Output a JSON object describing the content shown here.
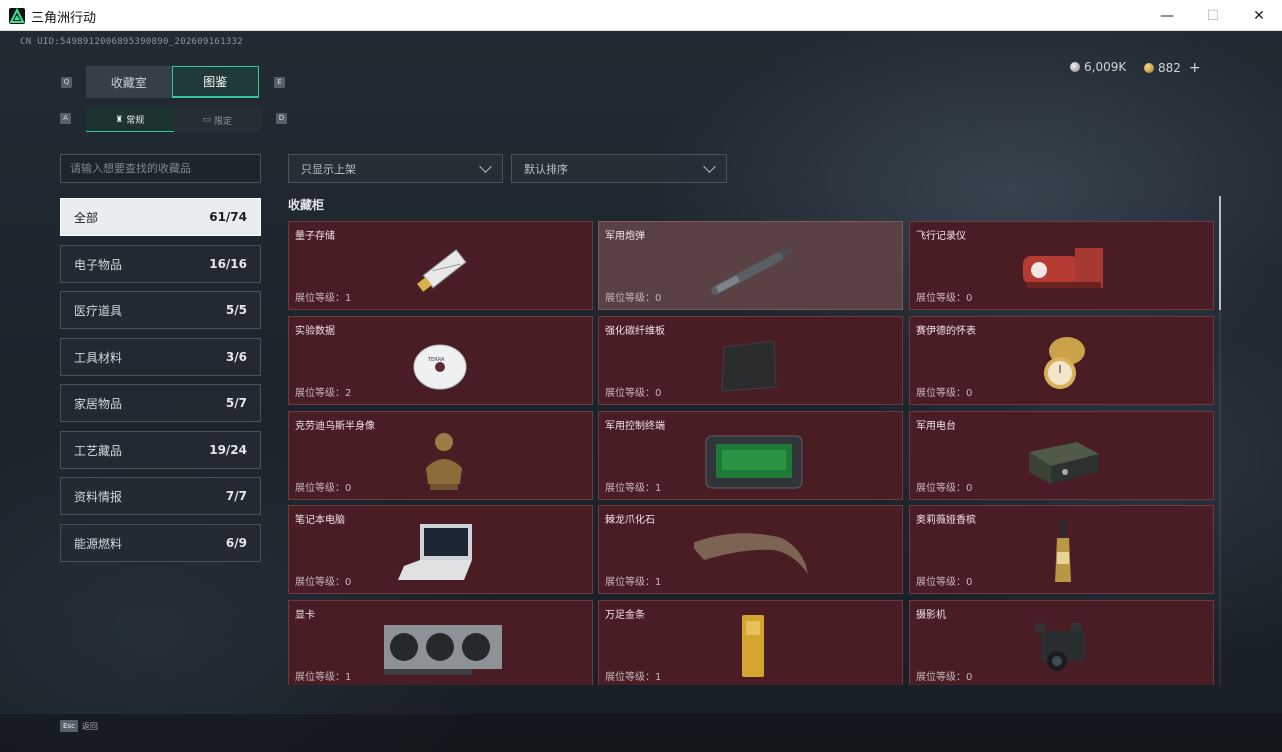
{
  "window": {
    "title": "三角洲行动",
    "min": "—",
    "max": "☐",
    "close": "✕"
  },
  "uid": "CN UID:5498912006895390890_202609161332",
  "key_hints": {
    "tab_prev": "Q",
    "tab_next": "E",
    "sub_prev": "A",
    "sub_next": "D"
  },
  "tabs": [
    {
      "label": "收藏室",
      "active": false
    },
    {
      "label": "图鉴",
      "active": true
    }
  ],
  "subtabs": [
    {
      "label": "常规",
      "active": true
    },
    {
      "label": "限定",
      "active": false
    }
  ],
  "currency": {
    "silver": "6,009K",
    "gold": "882",
    "add": "+"
  },
  "search": {
    "placeholder": "请输入想要查找的收藏品"
  },
  "filters": {
    "show": "只显示上架",
    "sort": "默认排序"
  },
  "categories": [
    {
      "label": "全部",
      "count": "61/74",
      "active": true
    },
    {
      "label": "电子物品",
      "count": "16/16"
    },
    {
      "label": "医疗道具",
      "count": "5/5"
    },
    {
      "label": "工具材料",
      "count": "3/6"
    },
    {
      "label": "家居物品",
      "count": "5/7"
    },
    {
      "label": "工艺藏品",
      "count": "19/24"
    },
    {
      "label": "资料情报",
      "count": "7/7"
    },
    {
      "label": "能源燃料",
      "count": "6/9"
    }
  ],
  "section_title": "收藏柜",
  "items": [
    {
      "name": "量子存储",
      "level": "展位等级：1",
      "icon": "usb-drive"
    },
    {
      "name": "军用炮弹",
      "level": "展位等级：0",
      "icon": "artillery-shell",
      "highlight": true
    },
    {
      "name": "飞行记录仪",
      "level": "展位等级：0",
      "icon": "flight-recorder"
    },
    {
      "name": "实验数据",
      "level": "展位等级：2",
      "icon": "data-disc"
    },
    {
      "name": "强化碳纤维板",
      "level": "展位等级：0",
      "icon": "carbon-plate"
    },
    {
      "name": "赛伊德的怀表",
      "level": "展位等级：0",
      "icon": "pocket-watch"
    },
    {
      "name": "克劳迪乌斯半身像",
      "level": "展位等级：0",
      "icon": "bust-statue"
    },
    {
      "name": "军用控制终端",
      "level": "展位等级：1",
      "icon": "control-terminal"
    },
    {
      "name": "军用电台",
      "level": "展位等级：0",
      "icon": "military-radio"
    },
    {
      "name": "笔记本电脑",
      "level": "展位等级：0",
      "icon": "laptop"
    },
    {
      "name": "棘龙爪化石",
      "level": "展位等级：1",
      "icon": "claw-fossil"
    },
    {
      "name": "奥莉薇娅香槟",
      "level": "展位等级：0",
      "icon": "champagne"
    },
    {
      "name": "显卡",
      "level": "展位等级：1",
      "icon": "graphics-card"
    },
    {
      "name": "万足金条",
      "level": "展位等级：1",
      "icon": "gold-bar"
    },
    {
      "name": "摄影机",
      "level": "展位等级：0",
      "icon": "camera"
    }
  ],
  "bottom": {
    "esc_key": "Esc",
    "esc_label": "返回"
  }
}
